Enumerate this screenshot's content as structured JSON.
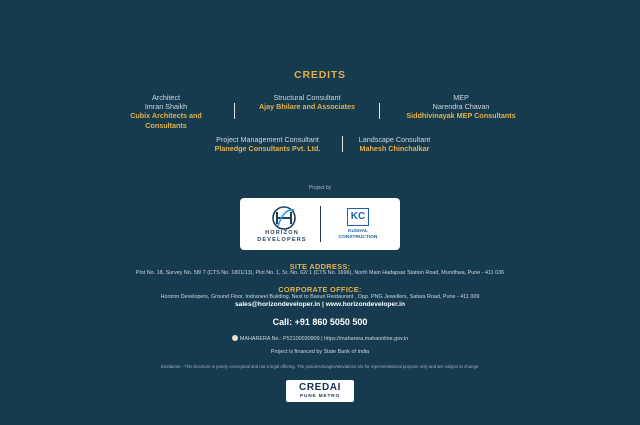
{
  "credits": {
    "title": "CREDITS",
    "row1": [
      {
        "role": "Architect",
        "name": "Imran Shaikh",
        "firm": "Cubix Architects and Consultants"
      },
      {
        "role": "Structural Consultant",
        "name": "",
        "firm": "Ajay Bhilare and Associates"
      },
      {
        "role": "MEP",
        "name": "Narendra Chavan",
        "firm": "Siddhivinayak MEP Consultants"
      }
    ],
    "row2": [
      {
        "role": "Project Management Consultant",
        "firm": "Planedge Consultants Pvt. Ltd."
      },
      {
        "role": "Landscape Consultant",
        "firm": "Mahesh Chinchalkar"
      }
    ]
  },
  "project_by": "Project by",
  "logos": {
    "horizon_line1": "HORIZON",
    "horizon_line2": "DEVELOPERS",
    "kc_mark": "KC",
    "kc_line1": "KUSHAL",
    "kc_line2": "CONSTRUCTION"
  },
  "site": {
    "title": "SITE ADDRESS:",
    "text": "Plot No. 18, Survey No. 58/ 7 (CTS No. 1801/13), Plot No. 1, Sr. No. 62/ 1 (CTS No. 1696), North Main Hadapsar Station Road, Mundhwa, Pune - 411 036"
  },
  "corporate": {
    "title": "CORPORATE OFFICE:",
    "text": "Horizon Developers, Ground Floor, Indraneel Building, Next to Basuri Restaurant , Opp. PNG Jewellers, Satara Road, Pune - 411 009",
    "contact": "sales@horizondeveloper.in  |  www.horizondeveloper.in"
  },
  "call": "Call: +91 860 5050 500",
  "maharera": "MAHARERA No.: P52100030909 | https://maharera.mahaonline.gov.in",
  "finance": "Project is financed by State Bank of India",
  "disclaimer": "Disclaimer - This brochure is purely conceptual and not a legal offering. The pictures/images/elevations are for representational purpose only and are subject to change.",
  "credai": {
    "name": "CREDAI",
    "sub": "PUNE METRO"
  },
  "colors": {
    "background": "#163a4e",
    "accent": "#e4b04a",
    "brand_navy": "#1d3f5c",
    "brand_blue": "#1d5fa8"
  }
}
